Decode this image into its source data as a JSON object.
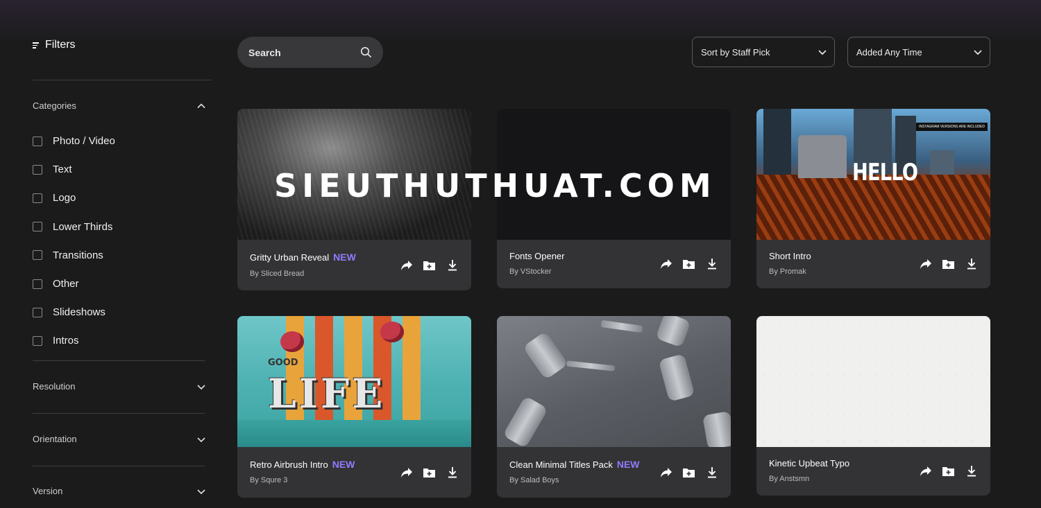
{
  "sidebar": {
    "filters_title": "Filters",
    "categories_heading": "Categories",
    "categories": [
      {
        "label": "Photo / Video"
      },
      {
        "label": "Text"
      },
      {
        "label": "Logo"
      },
      {
        "label": "Lower Thirds"
      },
      {
        "label": "Transitions"
      },
      {
        "label": "Other"
      },
      {
        "label": "Slideshows"
      },
      {
        "label": "Intros"
      }
    ],
    "sections": [
      {
        "label": "Resolution"
      },
      {
        "label": "Orientation"
      },
      {
        "label": "Version"
      }
    ]
  },
  "toolbar": {
    "search_label": "Search",
    "sort_label": "Sort by Staff Pick",
    "time_label": "Added Any Time"
  },
  "cards": [
    {
      "title": "Gritty Urban Reveal",
      "badge": "NEW",
      "author": "By Sliced Bread"
    },
    {
      "title": "Fonts Opener",
      "badge": "",
      "author": "By VStocker"
    },
    {
      "title": "Short Intro",
      "badge": "",
      "author": "By Promak",
      "thumb_text": "HELLO",
      "thumb_note": "INSTAGRAM VERSIONS ARE INCLUDED"
    },
    {
      "title": "Retro Airbrush Intro",
      "badge": "NEW",
      "author": "By Squre 3",
      "thumb_text": "LIFE",
      "thumb_note": "GOOD"
    },
    {
      "title": "Clean Minimal Titles Pack",
      "badge": "NEW",
      "author": "By Salad Boys"
    },
    {
      "title": "Kinetic Upbeat Typo",
      "badge": "",
      "author": "By Anstsmn"
    }
  ],
  "watermark": "SIEUTHUTHUAT.COM",
  "colors": {
    "accent_new": "#8f7cff",
    "background": "#1b1b1c",
    "card": "#333335"
  }
}
